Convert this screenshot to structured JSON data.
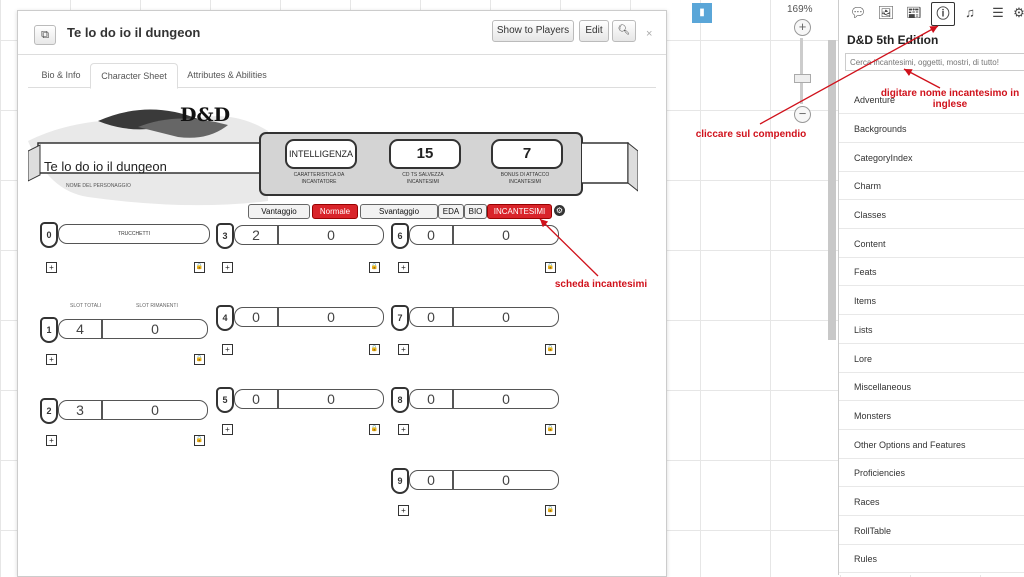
{
  "dialog": {
    "title": "Te lo do io il dungeon",
    "icon": "copy-icon",
    "show_players_label": "Show to Players",
    "edit_label": "Edit",
    "search_icon": "search-icon",
    "close_icon": "close-icon",
    "tabs": [
      {
        "label": "Bio & Info"
      },
      {
        "label": "Character Sheet"
      },
      {
        "label": "Attributes & Abilities"
      }
    ]
  },
  "sheet": {
    "logo": "D&D",
    "character_name": "Te lo do io il dungeon",
    "character_name_label": "NOME DEL PERSONAGGIO",
    "casting_stat": {
      "value": "INTELLIGENZA",
      "label": "CARATTERISTICA DA INCANTATORE"
    },
    "save_dc": {
      "value": "15",
      "label": "CD TS SALVEZZA INCANTESIMI"
    },
    "attack_bonus": {
      "value": "7",
      "label": "BONUS DI ATTACCO INCANTESIMI"
    },
    "roll_toggles": [
      {
        "label": "Vantaggio",
        "active": false
      },
      {
        "label": "Normale",
        "active": true
      },
      {
        "label": "Svantaggio",
        "active": false
      }
    ],
    "page_tabs": [
      {
        "label": "EDA",
        "active": false
      },
      {
        "label": "BIO",
        "active": false
      },
      {
        "label": "INCANTESIMI",
        "active": true
      }
    ],
    "cantrips_label": "TRUCCHETTI",
    "slots_total_label": "SLOT TOTALI",
    "slots_remaining_label": "SLOT RIMANENTI",
    "levels": [
      {
        "level": "0"
      },
      {
        "level": "1",
        "total": "4",
        "remaining": "0"
      },
      {
        "level": "2",
        "total": "3",
        "remaining": "0"
      },
      {
        "level": "3",
        "total": "2",
        "remaining": "0"
      },
      {
        "level": "4",
        "total": "0",
        "remaining": "0"
      },
      {
        "level": "5",
        "total": "0",
        "remaining": "0"
      },
      {
        "level": "6",
        "total": "0",
        "remaining": "0"
      },
      {
        "level": "7",
        "total": "0",
        "remaining": "0"
      },
      {
        "level": "8",
        "total": "0",
        "remaining": "0"
      },
      {
        "level": "9",
        "total": "0",
        "remaining": "0"
      }
    ],
    "add_symbol": "+",
    "lock_symbol": "🔒"
  },
  "zoom": {
    "label": "169%"
  },
  "panel": {
    "title": "D&D 5th Edition",
    "search_placeholder": "Cerca incantesimi, oggetti, mostri, di tutto!",
    "items": [
      "Adventure",
      "Backgrounds",
      "CategoryIndex",
      "Charm",
      "Classes",
      "Content",
      "Feats",
      "Items",
      "Lists",
      "Lore",
      "Miscellaneous",
      "Monsters",
      "Other Options and Features",
      "Proficiencies",
      "Races",
      "RollTable",
      "Rules"
    ]
  },
  "annotations": {
    "compendium": "cliccare sul compendio",
    "search": "digitare nome incantesimo in inglese",
    "spells": "scheda incantesimi"
  },
  "colors": {
    "accent_red": "#d9242a",
    "annotation_red": "#d0111b",
    "blue_tool": "#5aa6d8"
  }
}
